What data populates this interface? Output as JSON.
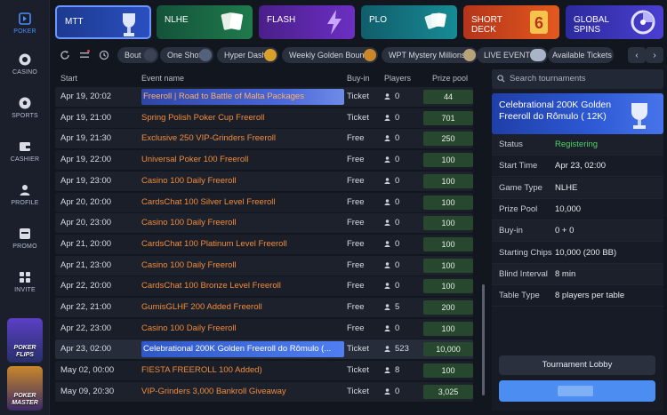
{
  "sidebar": {
    "items": [
      {
        "label": "POKER",
        "icon": "poker-icon",
        "active": true
      },
      {
        "label": "CASINO",
        "icon": "casino-chip-icon"
      },
      {
        "label": "SPORTS",
        "icon": "soccer-ball-icon"
      },
      {
        "label": "CASHIER",
        "icon": "wallet-icon"
      },
      {
        "label": "PROFILE",
        "icon": "user-icon"
      },
      {
        "label": "PROMO",
        "icon": "promo-card-icon"
      },
      {
        "label": "INVITE",
        "icon": "invite-icon"
      }
    ],
    "promos": [
      {
        "label": "POKER FLIPS"
      },
      {
        "label": "POKER MASTER"
      }
    ]
  },
  "game_tiles": [
    {
      "label": "MTT",
      "icon": "trophy-icon",
      "active": true
    },
    {
      "label": "NLHE",
      "icon": "cards-icon"
    },
    {
      "label": "FLASH",
      "icon": "lightning-icon"
    },
    {
      "label": "PLO",
      "icon": "cards-fan-icon"
    },
    {
      "label": "SHORT DECK",
      "icon": "six-icon"
    },
    {
      "label": "GLOBAL SPINS",
      "icon": "spin-wheel-icon"
    }
  ],
  "filters": {
    "icons": [
      "refresh-icon",
      "filter-settings-icon",
      "history-icon"
    ],
    "chips": [
      "Bout",
      "One Shot",
      "Hyper Dash",
      "Weekly Golden Bounty",
      "WPT Mystery Millions",
      "LIVE EVENT",
      "Available Tickets"
    ]
  },
  "table": {
    "headers": {
      "start": "Start",
      "event": "Event name",
      "buyin": "Buy-in",
      "players": "Players",
      "prize": "Prize pool"
    },
    "rows": [
      {
        "start": "Apr 19, 20:02",
        "event": "Freeroll | Road to Battle of Malta Packages",
        "buyin": "Ticket",
        "players": "0",
        "prize": "44"
      },
      {
        "start": "Apr 19, 21:00",
        "event": "Spring Polish Poker Cup Freeroll",
        "buyin": "Ticket",
        "players": "0",
        "prize": "701"
      },
      {
        "start": "Apr 19, 21:30",
        "event": "Exclusive 250 VIP-Grinders Freeroll",
        "buyin": "Free",
        "players": "0",
        "prize": "250"
      },
      {
        "start": "Apr 19, 22:00",
        "event": "Universal Poker 100 Freeroll",
        "buyin": "Free",
        "players": "0",
        "prize": "100"
      },
      {
        "start": "Apr 19, 23:00",
        "event": "Casino 100 Daily Freeroll",
        "buyin": "Free",
        "players": "0",
        "prize": "100"
      },
      {
        "start": "Apr 20, 20:00",
        "event": "CardsChat 100 Silver Level Freeroll",
        "buyin": "Free",
        "players": "0",
        "prize": "100"
      },
      {
        "start": "Apr 20, 23:00",
        "event": "Casino 100 Daily Freeroll",
        "buyin": "Free",
        "players": "0",
        "prize": "100"
      },
      {
        "start": "Apr 21, 20:00",
        "event": "CardsChat 100 Platinum Level Freeroll",
        "buyin": "Free",
        "players": "0",
        "prize": "100"
      },
      {
        "start": "Apr 21, 23:00",
        "event": "Casino 100 Daily Freeroll",
        "buyin": "Free",
        "players": "0",
        "prize": "100"
      },
      {
        "start": "Apr 22, 20:00",
        "event": "CardsChat 100 Bronze Level Freeroll",
        "buyin": "Free",
        "players": "0",
        "prize": "100"
      },
      {
        "start": "Apr 22, 21:00",
        "event": "GumisGLHF 200 Added Freeroll",
        "buyin": "Free",
        "players": "5",
        "prize": "200"
      },
      {
        "start": "Apr 22, 23:00",
        "event": "Casino 100 Daily Freeroll",
        "buyin": "Free",
        "players": "0",
        "prize": "100"
      },
      {
        "start": "Apr 23, 02:00",
        "event": "Celebrational 200K Golden Freeroll do Rômulo (...",
        "buyin": "Ticket",
        "players": "523",
        "prize": "10,000"
      },
      {
        "start": "May 02, 00:00",
        "event": "FIESTA FREEROLL 100 Added)",
        "buyin": "Ticket",
        "players": "8",
        "prize": "100"
      },
      {
        "start": "May 09, 20:30",
        "event": "VIP-Grinders 3,000 Bankroll Giveaway",
        "buyin": "Ticket",
        "players": "0",
        "prize": "3,025"
      }
    ]
  },
  "panel": {
    "search_placeholder": "Search tournaments",
    "banner_title": "Celebrational 200K Golden Freeroll do Rômulo ( 12K)",
    "details": [
      {
        "label": "Status",
        "value": "Registering",
        "color": "#52d06a"
      },
      {
        "label": "Start Time",
        "value": "Apr 23, 02:00"
      },
      {
        "label": "Game Type",
        "value": "NLHE"
      },
      {
        "label": "Prize Pool",
        "value": "10,000"
      },
      {
        "label": "Buy-in",
        "value": "0 + 0"
      },
      {
        "label": "Starting Chips",
        "value": "10,000 (200 BB)"
      },
      {
        "label": "Blind Interval",
        "value": "8 min"
      },
      {
        "label": "Table Type",
        "value": "8 players per table"
      }
    ],
    "lobby_button": "Tournament Lobby"
  },
  "colors": {
    "accent": "#4a8dff",
    "event_text": "#f28c3b",
    "prize_bg": "#27472f",
    "status_green": "#52d06a"
  }
}
